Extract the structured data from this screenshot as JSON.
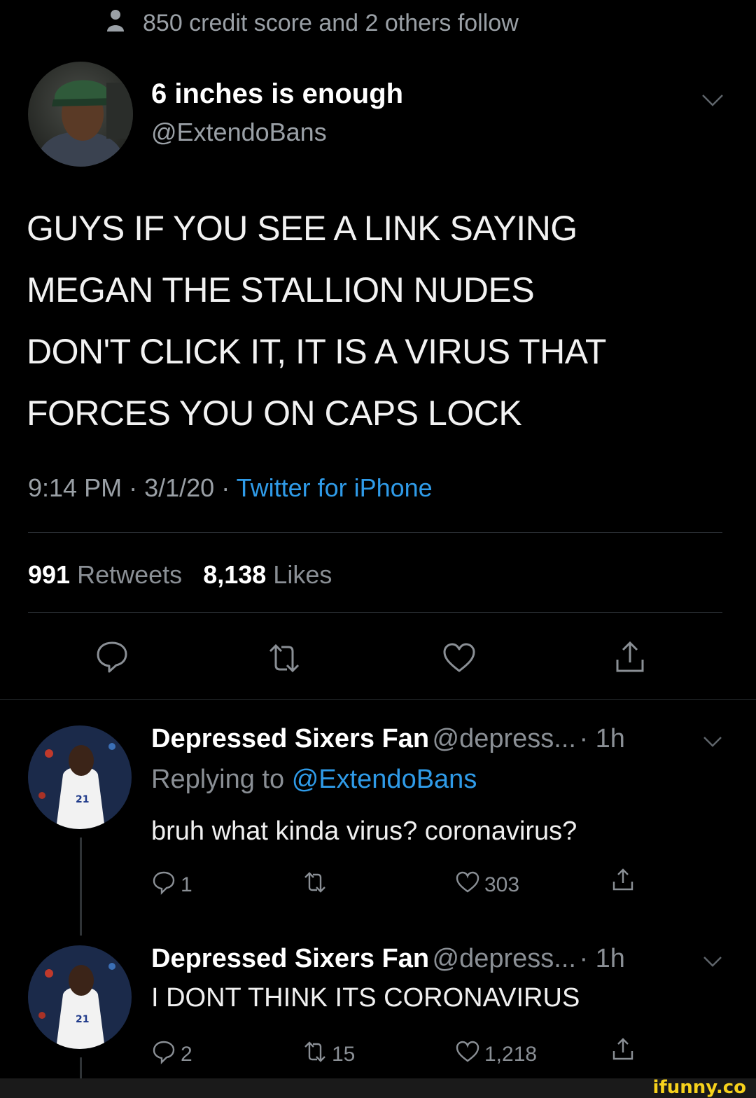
{
  "social_context": {
    "text": "850 credit score and 2 others follow"
  },
  "main_tweet": {
    "display_name": "6 inches is enough",
    "handle": "@ExtendoBans",
    "text_lines": [
      "GUYS IF YOU SEE A LINK SAYING",
      "MEGAN THE STALLION NUDES",
      "DON'T CLICK IT, IT IS A VIRUS THAT",
      "FORCES YOU ON CAPS LOCK"
    ],
    "time": "9:14 PM",
    "date": "3/1/20",
    "separator": "·",
    "client": "Twitter for iPhone",
    "retweet_count": "991",
    "retweet_label": "Retweets",
    "like_count": "8,138",
    "like_label": "Likes"
  },
  "replies": [
    {
      "display_name": "Depressed Sixers Fan",
      "handle": "@depress...",
      "age": "· 1h",
      "replying_to_label": "Replying to",
      "replying_to_handle": "@ExtendoBans",
      "text": "bruh what kinda virus? coronavirus?",
      "reply_count": "1",
      "retweet_count": "",
      "like_count": "303"
    },
    {
      "display_name": "Depressed Sixers Fan",
      "handle": "@depress...",
      "age": "· 1h",
      "text": "I DONT THINK ITS CORONAVIRUS",
      "reply_count": "2",
      "retweet_count": "15",
      "like_count": "1,218"
    }
  ],
  "watermark": "ifunny.co",
  "colors": {
    "background": "#000000",
    "link_blue": "#2f9be8",
    "muted": "#8a8f95"
  },
  "icons": [
    "person-icon",
    "chevron-down-icon",
    "reply-icon",
    "retweet-icon",
    "like-icon",
    "share-icon"
  ]
}
